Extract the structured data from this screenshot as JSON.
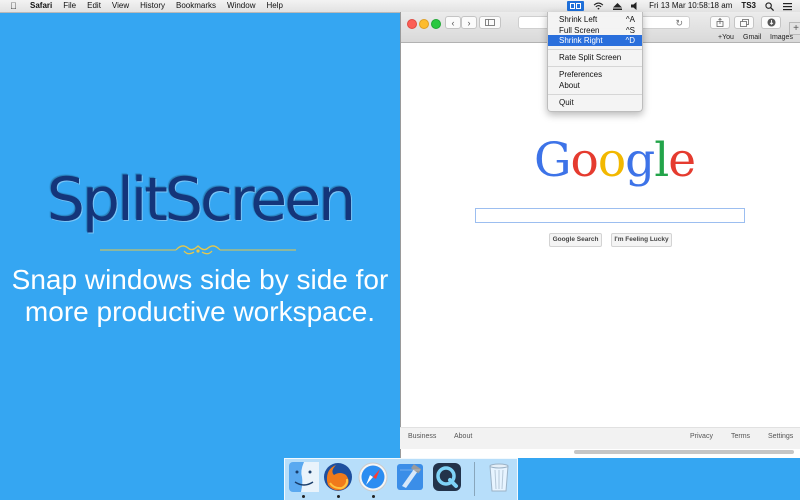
{
  "menubar": {
    "app": "Safari",
    "items": [
      "File",
      "Edit",
      "View",
      "History",
      "Bookmarks",
      "Window",
      "Help"
    ],
    "clock": "Fri 13 Mar  10:58:18 am",
    "user": "TS3"
  },
  "dropdown": {
    "items": [
      {
        "label": "Shrink Left",
        "shortcut": "^A"
      },
      {
        "label": "Full Screen",
        "shortcut": "^S"
      },
      {
        "label": "Shrink Right",
        "shortcut": "^D"
      },
      {
        "label": "Rate Split Screen",
        "shortcut": ""
      },
      {
        "label": "Preferences",
        "shortcut": ""
      },
      {
        "label": "About",
        "shortcut": ""
      },
      {
        "label": "Quit",
        "shortcut": ""
      }
    ],
    "selected": "Shrink Right"
  },
  "promo": {
    "title": "SplitScreen",
    "subtitle": "Snap windows side by side for more productive workspace.",
    "title_color": "#14357a",
    "ornament_color": "#e8c84a"
  },
  "google": {
    "top_links": [
      "+You",
      "Gmail",
      "Images"
    ],
    "logo": {
      "g1": "G",
      "o1": "o",
      "o2": "o",
      "g2": "g",
      "l": "l",
      "e": "e"
    },
    "search_button": "Google Search",
    "lucky_button": "I'm Feeling Lucky",
    "footer_left": [
      "Business",
      "About"
    ],
    "footer_right": [
      "Privacy",
      "Terms",
      "Settings"
    ]
  },
  "dock": {
    "apps": [
      "finder-icon",
      "firefox-icon",
      "safari-icon",
      "xcode-icon",
      "quicktime-icon",
      "trash-icon"
    ]
  },
  "colors": {
    "desktop": "#35a6f2",
    "menu_highlight": "#2a6fdc"
  }
}
